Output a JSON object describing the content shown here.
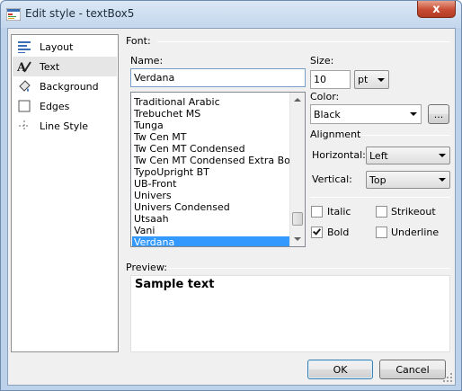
{
  "window": {
    "title": "Edit style - textBox5",
    "close_glyph": "x"
  },
  "nav": {
    "items": [
      {
        "label": "Layout",
        "icon": "layout-icon"
      },
      {
        "label": "Text",
        "icon": "text-icon",
        "selected": true
      },
      {
        "label": "Background",
        "icon": "background-icon"
      },
      {
        "label": "Edges",
        "icon": "edges-icon"
      },
      {
        "label": "Line Style",
        "icon": "line-style-icon"
      }
    ]
  },
  "font": {
    "group_label": "Font:",
    "name_label": "Name:",
    "name_value": "Verdana",
    "size_label": "Size:",
    "size_value": "10",
    "unit_value": "pt",
    "color_label": "Color:",
    "color_value": "Black",
    "color_browse": "...",
    "font_list": [
      "Traditional Arabic",
      "Trebuchet MS",
      "Tunga",
      "Tw Cen MT",
      "Tw Cen MT Condensed",
      "Tw Cen MT Condensed Extra Bold",
      "TypoUpright BT",
      "UB-Front",
      "Univers",
      "Univers Condensed",
      "Utsaah",
      "Vani",
      "Verdana"
    ],
    "selected_font": "Verdana"
  },
  "alignment": {
    "group_label": "Alignment",
    "horizontal_label": "Horizontal:",
    "horizontal_value": "Left",
    "vertical_label": "Vertical:",
    "vertical_value": "Top"
  },
  "styles": {
    "italic_label": "Italic",
    "italic": false,
    "strikeout_label": "Strikeout",
    "strikeout": false,
    "bold_label": "Bold",
    "bold": true,
    "underline_label": "Underline",
    "underline": false
  },
  "preview": {
    "label": "Preview:",
    "text": "Sample text"
  },
  "buttons": {
    "ok": "OK",
    "cancel": "Cancel"
  },
  "colors": {
    "selection": "#3399ff",
    "close_button": "#c74c33",
    "title_bar": "#c3d6ec"
  }
}
